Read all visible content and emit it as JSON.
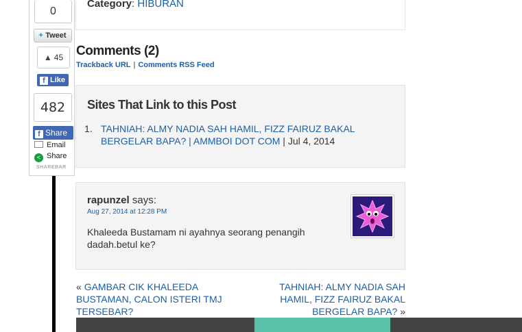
{
  "sharebar": {
    "tweet_count": "0",
    "tweet_label": "Tweet",
    "like_count": "45",
    "like_label": "Like",
    "share_count": "482",
    "share_label": "Share",
    "email_label": "Email",
    "share2_label": "Share",
    "brand": "SHAREBAR"
  },
  "category": {
    "label": "Category",
    "value": "HIBURAN"
  },
  "comments": {
    "title": "Comments (2)",
    "trackback_label": "Trackback URL",
    "separator": "|",
    "rss_label": "Comments RSS Feed"
  },
  "pingbacks": {
    "title": "Sites That Link to this Post",
    "items": [
      {
        "num": "1.",
        "link": "TAHNIAH: ALMY NADIA SAH HAMIL, FIZZ FAIRUZ BAKAL BERGELAR BAPA? | AMMBOI DOT COM",
        "date": " | Jul 4, 2014"
      }
    ]
  },
  "comment": {
    "author": "rapunzel",
    "says": " says:",
    "date": "Aug 27, 2014 at 12:28 PM",
    "text": "Khaleeda Bustamam ni ayahnya seorang penangih dadah.betul ke?"
  },
  "post_nav": {
    "prev_arrow": "«",
    "prev_label": "GAMBAR CIK KHALEEDA BUSTAMAN, CALON ISTERI TMJ TERSEBAR?",
    "next_label": "TAHNIAH: ALMY NADIA SAH HAMIL, FIZZ FAIRUZ BAKAL BERGELAR BAPA?",
    "next_arrow": "»"
  },
  "colors": {
    "link": "#1b5fa8",
    "facebook": "#4267b2",
    "footer": "#444444",
    "footer_accent": "#5bc0a8"
  }
}
